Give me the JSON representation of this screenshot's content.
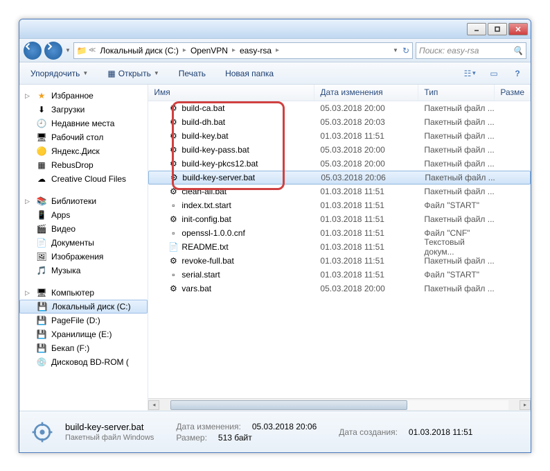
{
  "titlebar": {},
  "nav": {
    "breadcrumb": [
      "Локальный диск (C:)",
      "OpenVPN",
      "easy-rsa"
    ],
    "search_placeholder": "Поиск: easy-rsa"
  },
  "toolbar": {
    "organize": "Упорядочить",
    "open": "Открыть",
    "print": "Печать",
    "new_folder": "Новая папка"
  },
  "sidebar": {
    "favorites": {
      "label": "Избранное",
      "items": [
        "Загрузки",
        "Недавние места",
        "Рабочий стол",
        "Яндекс.Диск",
        "RebusDrop",
        "Creative Cloud Files"
      ]
    },
    "libraries": {
      "label": "Библиотеки",
      "items": [
        "Apps",
        "Видео",
        "Документы",
        "Изображения",
        "Музыка"
      ]
    },
    "computer": {
      "label": "Компьютер",
      "items": [
        "Локальный диск (C:)",
        "PageFile (D:)",
        "Хранилище (E:)",
        "Бекап (F:)",
        "Дисковод BD-ROM ("
      ]
    }
  },
  "columns": {
    "name": "Имя",
    "date": "Дата изменения",
    "type": "Тип",
    "size": "Разме"
  },
  "files": [
    {
      "name": "build-ca.bat",
      "date": "05.03.2018 20:00",
      "type": "Пакетный файл ...",
      "icon": "bat"
    },
    {
      "name": "build-dh.bat",
      "date": "05.03.2018 20:03",
      "type": "Пакетный файл ...",
      "icon": "bat"
    },
    {
      "name": "build-key.bat",
      "date": "01.03.2018 11:51",
      "type": "Пакетный файл ...",
      "icon": "bat"
    },
    {
      "name": "build-key-pass.bat",
      "date": "05.03.2018 20:00",
      "type": "Пакетный файл ...",
      "icon": "bat"
    },
    {
      "name": "build-key-pkcs12.bat",
      "date": "05.03.2018 20:00",
      "type": "Пакетный файл ...",
      "icon": "bat"
    },
    {
      "name": "build-key-server.bat",
      "date": "05.03.2018 20:06",
      "type": "Пакетный файл ...",
      "icon": "bat",
      "selected": true
    },
    {
      "name": "clean-all.bat",
      "date": "01.03.2018 11:51",
      "type": "Пакетный файл ...",
      "icon": "bat"
    },
    {
      "name": "index.txt.start",
      "date": "01.03.2018 11:51",
      "type": "Файл \"START\"",
      "icon": "file"
    },
    {
      "name": "init-config.bat",
      "date": "01.03.2018 11:51",
      "type": "Пакетный файл ...",
      "icon": "bat"
    },
    {
      "name": "openssl-1.0.0.cnf",
      "date": "01.03.2018 11:51",
      "type": "Файл \"CNF\"",
      "icon": "file"
    },
    {
      "name": "README.txt",
      "date": "01.03.2018 11:51",
      "type": "Текстовый докум...",
      "icon": "txt"
    },
    {
      "name": "revoke-full.bat",
      "date": "01.03.2018 11:51",
      "type": "Пакетный файл ...",
      "icon": "bat"
    },
    {
      "name": "serial.start",
      "date": "01.03.2018 11:51",
      "type": "Файл \"START\"",
      "icon": "file"
    },
    {
      "name": "vars.bat",
      "date": "05.03.2018 20:00",
      "type": "Пакетный файл ...",
      "icon": "bat"
    }
  ],
  "details": {
    "filename": "build-key-server.bat",
    "filetype": "Пакетный файл Windows",
    "modified_label": "Дата изменения:",
    "modified": "05.03.2018 20:06",
    "size_label": "Размер:",
    "size": "513 байт",
    "created_label": "Дата создания:",
    "created": "01.03.2018 11:51"
  }
}
